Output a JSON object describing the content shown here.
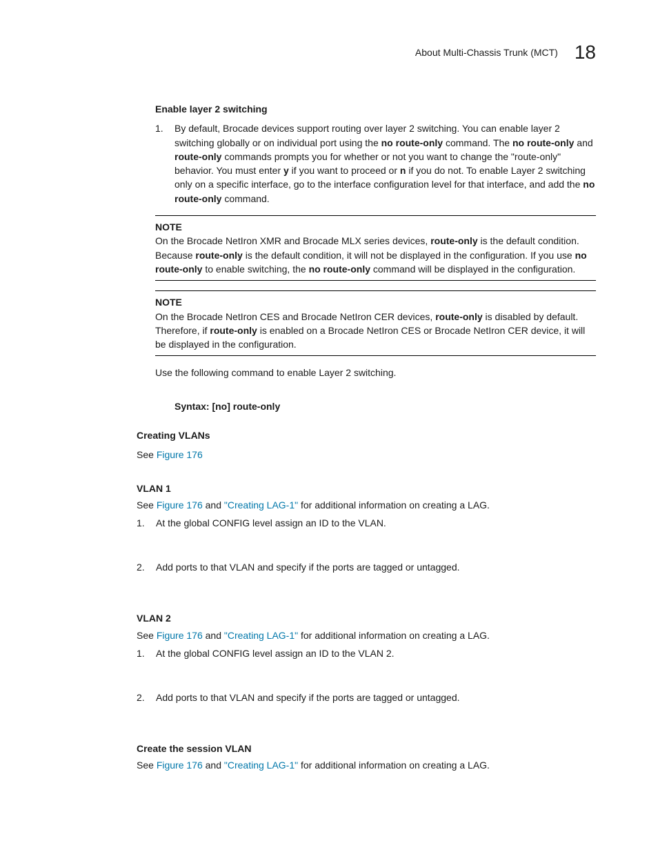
{
  "header": {
    "title": "About Multi-Chassis Trunk (MCT)",
    "chapter": "18"
  },
  "section1": {
    "heading": "Enable layer 2 switching",
    "item_num": "1.",
    "item_text_parts": {
      "a": "By default, Brocade devices support routing over layer 2 switching. You can enable layer 2 switching globally or on individual port using the ",
      "b": "no route-only",
      "c": " command. The ",
      "d": "no route-only",
      "e": " and ",
      "f": "route-only",
      "g": " commands prompts you for whether or not you want to change the \"route-only\" behavior. You must enter ",
      "h": "y",
      "i": " if you want to proceed or ",
      "j": "n",
      "k": " if you do not. To enable Layer 2 switching only on a specific interface, go to the interface configuration level for that interface, and add the ",
      "l": "no route-only",
      "m": " command."
    }
  },
  "note1": {
    "label": "NOTE",
    "parts": {
      "a": "On the Brocade NetIron XMR and Brocade MLX series devices, ",
      "b": "route-only",
      "c": " is the default condition. Because ",
      "d": "route-only",
      "e": " is the default condition, it will not be displayed in the configuration. If you use ",
      "f": "no route-only",
      "g": " to enable switching, the ",
      "h": "no route-only",
      "i": " command will be displayed in the configuration."
    }
  },
  "note2": {
    "label": "NOTE",
    "parts": {
      "a": "On the Brocade NetIron CES and Brocade NetIron CER devices, ",
      "b": "route-only",
      "c": " is disabled by default. Therefore, if ",
      "d": "route-only",
      "e": " is enabled on a Brocade NetIron CES or Brocade NetIron CER device, it will be displayed in the configuration."
    }
  },
  "para_use": "Use the following command to enable Layer 2 switching.",
  "syntax": {
    "label": "Syntax:  ",
    "cmd": "[no] route-only"
  },
  "creating_vlans": {
    "heading": "Creating VLANs",
    "see": "See ",
    "fig": "Figure 176"
  },
  "vlan1": {
    "heading": "VLAN 1",
    "see_a": "See ",
    "fig": "Figure 176",
    "see_b": " and ",
    "link": "\"Creating LAG-1\"",
    "see_c": " for additional information on creating a LAG.",
    "step1_num": "1.",
    "step1": "At the global CONFIG level assign an ID to the VLAN.",
    "step2_num": "2.",
    "step2": "Add ports to that VLAN and specify if the ports are tagged or untagged."
  },
  "vlan2": {
    "heading": "VLAN 2",
    "see_a": "See ",
    "fig": "Figure 176",
    "see_b": " and ",
    "link": "\"Creating LAG-1\"",
    "see_c": " for additional information on creating a LAG.",
    "step1_num": "1.",
    "step1": "At the global CONFIG level assign an ID to the VLAN 2.",
    "step2_num": "2.",
    "step2": "Add ports to that VLAN and specify if the ports are tagged or untagged."
  },
  "session_vlan": {
    "heading": "Create the session VLAN",
    "see_a": "See ",
    "fig": "Figure 176",
    "see_b": " and ",
    "link": "\"Creating LAG-1\"",
    "see_c": " for additional information on creating a LAG."
  }
}
